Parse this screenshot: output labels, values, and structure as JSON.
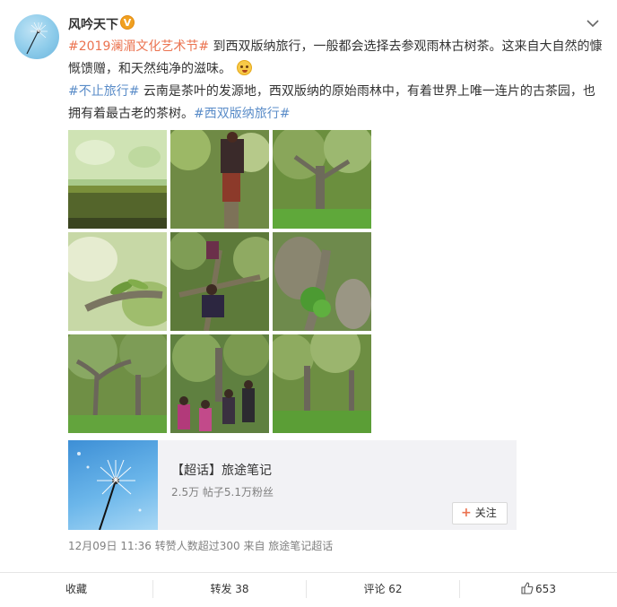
{
  "user": {
    "name": "风吟天下",
    "verified_badge": "V",
    "verified_color": "#f0a020"
  },
  "post": {
    "line1_tag": "#2019澜湄文化艺术节#",
    "line1_text": " 到西双版纳旅行，一般都会选择去参观雨林古树茶。这来自大自然的慷慨馈赠，和天然纯净的滋味。",
    "line2_tag": "#不止旅行#",
    "line2_text": " 云南是茶叶的发源地，西双版纳的原始雨林中，有着世界上唯一连片的古茶园，也拥有着最古老的茶树。",
    "line2_tag_end": "#西双版纳旅行#",
    "tag_color": "#eb7350",
    "link_color": "#5a8cc8"
  },
  "card": {
    "title": "【超话】旅途笔记",
    "stats": "2.5万 帖子5.1万粉丝",
    "follow_plus": "+",
    "follow_label": "关注"
  },
  "meta": {
    "text": "12月09日 11:36 转赞人数超过300  来自 旅途笔记超话"
  },
  "actions": {
    "collect": "收藏",
    "repost": "转发 38",
    "comment": "评论 62",
    "like": "653"
  },
  "icons": {
    "more": "chevron-down-icon",
    "like": "thumbs-up-icon",
    "emoji": "smile-emoji-icon"
  }
}
